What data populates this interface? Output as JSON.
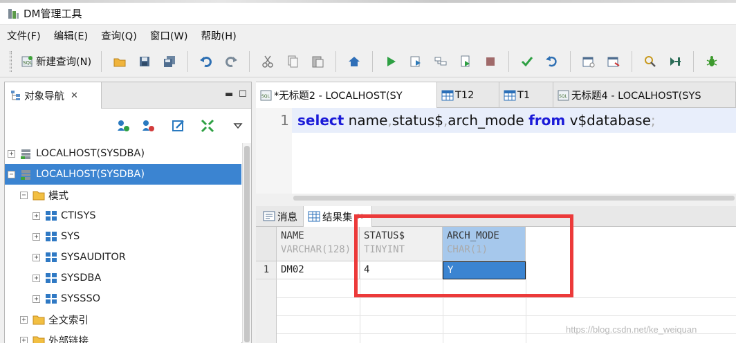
{
  "window": {
    "title": "DM管理工具"
  },
  "menu": [
    "文件(F)",
    "编辑(E)",
    "查询(Q)",
    "窗口(W)",
    "帮助(H)"
  ],
  "toolbar": {
    "new_query_label": "新建查询(N)",
    "icons": [
      "open-folder-icon",
      "save-icon",
      "save-all-icon",
      "undo-icon",
      "redo-icon",
      "cut-icon",
      "copy-icon",
      "paste-icon",
      "home-icon",
      "run-icon",
      "run-selection-icon",
      "explain-icon",
      "run-script-icon",
      "stop-icon",
      "commit-icon",
      "rollback-icon",
      "calendar-icon",
      "schedule-icon",
      "format-icon",
      "step-icon",
      "debug-icon"
    ]
  },
  "navigator": {
    "tab_label": "对象导航",
    "tree": [
      {
        "label": "LOCALHOST(SYSDBA)",
        "level": 0,
        "toggle": "+",
        "icon": "server-icon",
        "selected": false
      },
      {
        "label": "LOCALHOST(SYSDBA)",
        "level": 0,
        "toggle": "−",
        "icon": "server-icon",
        "selected": true
      },
      {
        "label": "模式",
        "level": 1,
        "toggle": "−",
        "icon": "folder-icon",
        "selected": false
      },
      {
        "label": "CTISYS",
        "level": 2,
        "toggle": "+",
        "icon": "schema-icon",
        "selected": false
      },
      {
        "label": "SYS",
        "level": 2,
        "toggle": "+",
        "icon": "schema-icon",
        "selected": false
      },
      {
        "label": "SYSAUDITOR",
        "level": 2,
        "toggle": "+",
        "icon": "schema-icon",
        "selected": false
      },
      {
        "label": "SYSDBA",
        "level": 2,
        "toggle": "+",
        "icon": "schema-icon",
        "selected": false
      },
      {
        "label": "SYSSSO",
        "level": 2,
        "toggle": "+",
        "icon": "schema-icon",
        "selected": false
      },
      {
        "label": "全文索引",
        "level": 1,
        "toggle": "+",
        "icon": "folder-icon",
        "selected": false
      },
      {
        "label": "外部链接",
        "level": 1,
        "toggle": "+",
        "icon": "folder-icon",
        "selected": false
      }
    ]
  },
  "editor_tabs": [
    {
      "label": "*无标题2 - LOCALHOST(SY",
      "icon": "sql-icon",
      "active": true
    },
    {
      "label": "T12",
      "icon": "table-icon",
      "active": false
    },
    {
      "label": "T1",
      "icon": "table-icon",
      "active": false
    },
    {
      "label": "无标题4 - LOCALHOST(SYS",
      "icon": "sql-icon",
      "active": false
    }
  ],
  "editor": {
    "line_number": "1",
    "tokens": [
      {
        "text": "select",
        "kind": "kw"
      },
      {
        "text": " name",
        "kind": "plain"
      },
      {
        "text": ",",
        "kind": "dim"
      },
      {
        "text": "status$",
        "kind": "plain"
      },
      {
        "text": ",",
        "kind": "dim"
      },
      {
        "text": "arch_mode ",
        "kind": "plain"
      },
      {
        "text": "from",
        "kind": "kw"
      },
      {
        "text": " v$database",
        "kind": "plain"
      },
      {
        "text": ";",
        "kind": "dim"
      }
    ]
  },
  "result_tabs": [
    {
      "label": "消息",
      "icon": "message-icon"
    },
    {
      "label": "结果集",
      "icon": "grid-icon",
      "active": true
    }
  ],
  "result_grid": {
    "columns": [
      {
        "name": "NAME",
        "type": "VARCHAR(128)"
      },
      {
        "name": "STATUS$",
        "type": "TINYINT"
      },
      {
        "name": "ARCH_MODE",
        "type": "CHAR(1)"
      }
    ],
    "rows": [
      {
        "num": "1",
        "cells": [
          "DM02",
          "4",
          "Y"
        ]
      }
    ]
  },
  "watermark": "https://blog.csdn.net/ke_weiquan"
}
